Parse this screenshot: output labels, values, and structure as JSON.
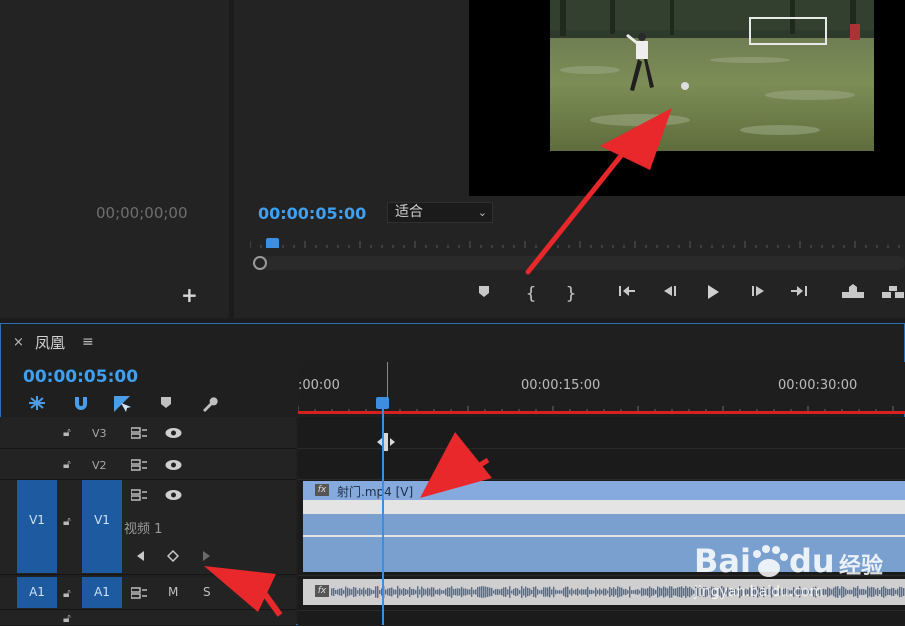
{
  "source_monitor": {
    "timecode": "00;00;00;00",
    "add_button": "+"
  },
  "program_monitor": {
    "timecode": "00:00:05:00",
    "fit_select": "适合"
  },
  "timeline": {
    "close": "×",
    "sequence_name": "凤凰",
    "menu": "≡",
    "timecode": "00:00:05:00",
    "ruler_labels": [
      ":00:00",
      "00:00:15:00",
      "00:00:30:00"
    ],
    "tracks": {
      "v3": "V3",
      "v2": "V2",
      "v1_source": "V1",
      "v1": "V1",
      "v1_name": "视频 1",
      "a1_source": "A1",
      "a1": "A1",
      "mute": "M",
      "solo": "S"
    },
    "video_clip": {
      "fx": "fx",
      "name": "射门.mp4 [V]"
    },
    "audio_clip": {
      "fx": "fx"
    }
  },
  "watermark": {
    "brand_left": "Bai",
    "brand_mid": "du",
    "brand_cn": "经验",
    "url": "jingyan.baidu.com"
  },
  "colors": {
    "accent_blue": "#3ea0f2",
    "track_blue": "#1e5aa0",
    "clip_blue": "#7aa0d0",
    "work_area_red": "#d82020",
    "annotation_arrow_red": "#e8282a"
  }
}
